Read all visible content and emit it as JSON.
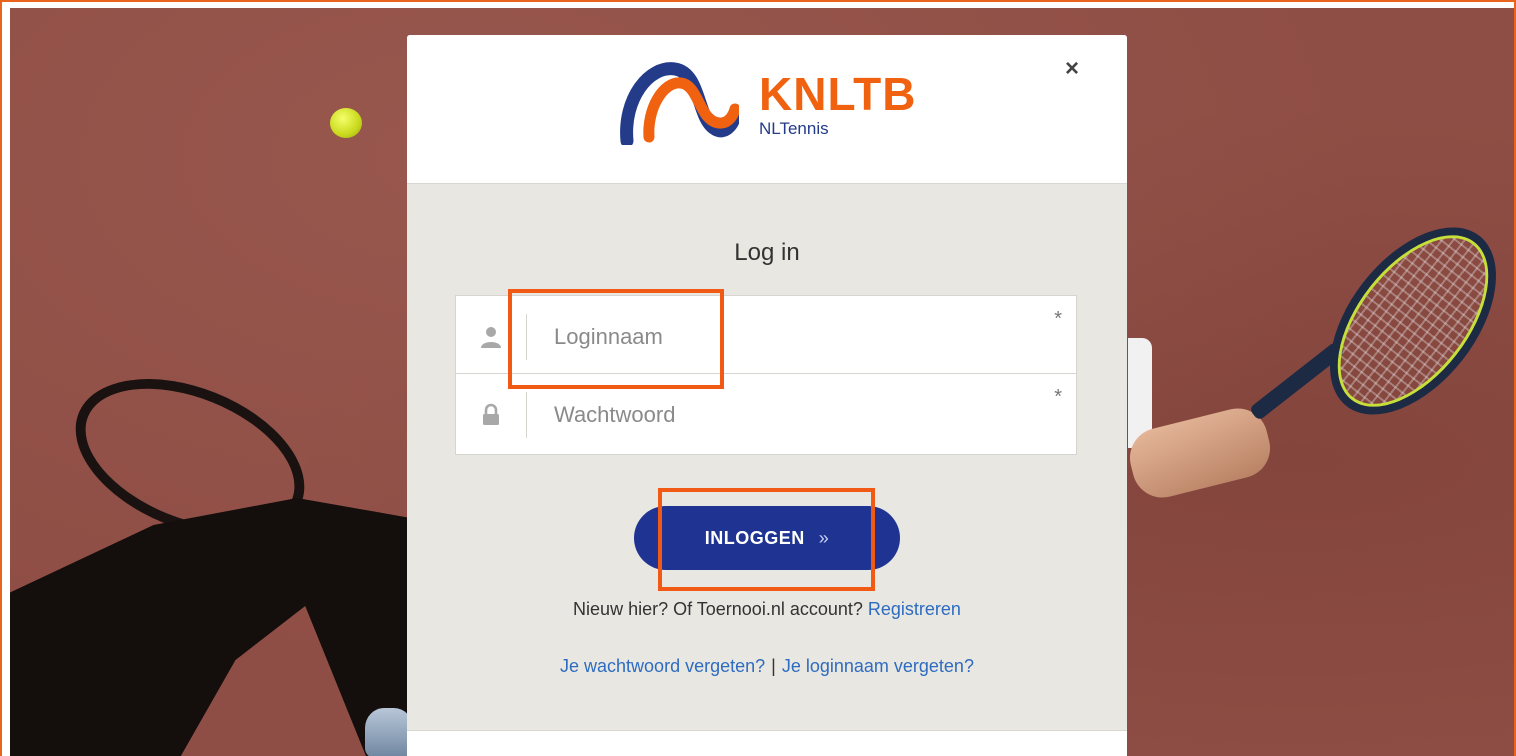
{
  "modal": {
    "brand": "KNLTB",
    "brand_sub": "NLTennis",
    "close_icon": "×",
    "title": "Log in",
    "username": {
      "placeholder": "Loginnaam",
      "required_mark": "*"
    },
    "password": {
      "placeholder": "Wachtwoord",
      "required_mark": "*"
    },
    "login_button": {
      "label": "INLOGGEN",
      "arrow": "»"
    },
    "register": {
      "text": "Nieuw hier? Of Toernooi.nl account? ",
      "link": "Registreren"
    },
    "forgot": {
      "password_link": "Je wachtwoord vergeten?",
      "separator": "|",
      "username_link": "Je loginnaam vergeten?"
    }
  },
  "colors": {
    "brand_orange": "#f0620f",
    "brand_blue": "#243b8a",
    "button_blue": "#1f3393",
    "link_blue": "#2d6cc0",
    "highlight": "#f05a14",
    "panel_bg": "#e9e7e2"
  },
  "icons": {
    "close": "close-icon",
    "user": "user-icon",
    "lock": "lock-icon"
  }
}
